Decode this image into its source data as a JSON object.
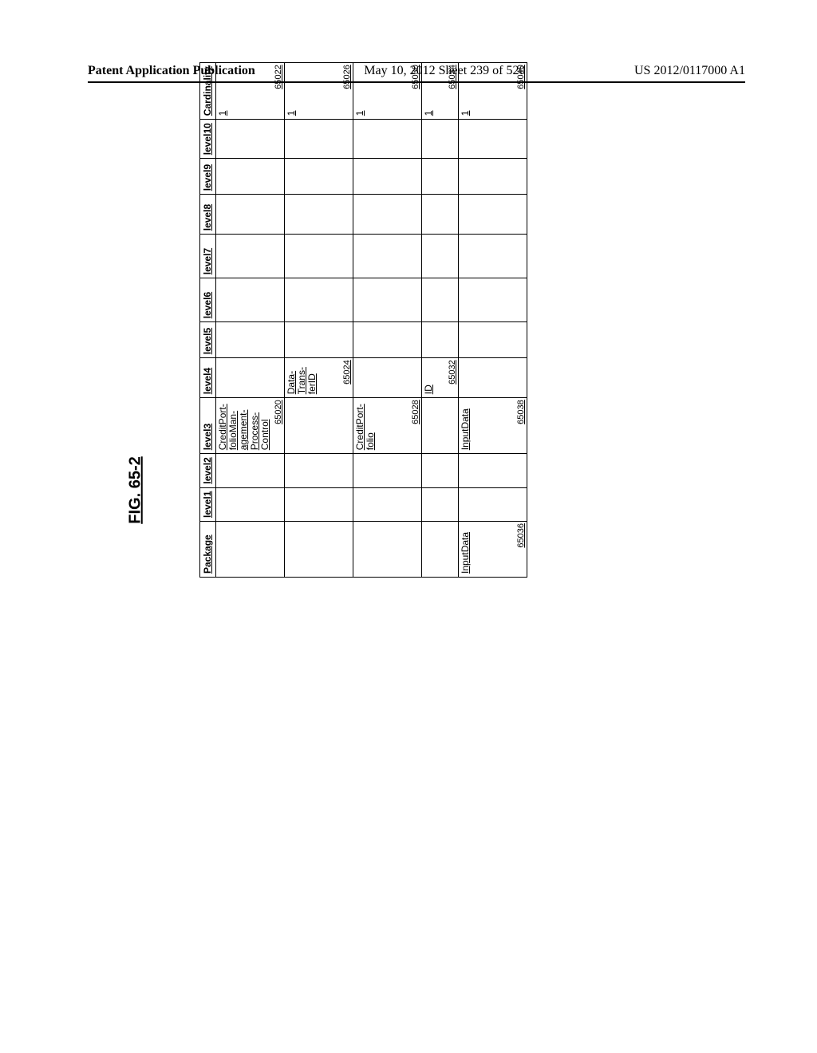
{
  "header": {
    "left": "Patent Application Publication",
    "mid": "May 10, 2012  Sheet 239 of 520",
    "right": "US 2012/0117000 A1"
  },
  "figure_label": "FIG. 65-2",
  "table": {
    "headers": [
      "Package",
      "level1",
      "level2",
      "level3",
      "level4",
      "level5",
      "level6",
      "level7",
      "level8",
      "level9",
      "level10",
      "Cardinality"
    ],
    "rows": [
      {
        "package": {
          "text": "",
          "ref": ""
        },
        "l3": {
          "text": "CreditPort-\nfolioMan-\nagement-\nProcess-\nControl",
          "ref": "65020"
        },
        "l4": {
          "text": "",
          "ref": ""
        },
        "card": {
          "text": "1",
          "ref": "65022"
        }
      },
      {
        "package": {
          "text": "",
          "ref": ""
        },
        "l3": {
          "text": "",
          "ref": ""
        },
        "l4": {
          "text": "Data-\nTrans-\nferID",
          "ref": "65024"
        },
        "card": {
          "text": "1",
          "ref": "65026"
        }
      },
      {
        "package": {
          "text": "",
          "ref": ""
        },
        "l3": {
          "text": "CreditPort-\nfolio",
          "ref": "65028"
        },
        "l4": {
          "text": "",
          "ref": ""
        },
        "card": {
          "text": "1",
          "ref": "65030"
        }
      },
      {
        "package": {
          "text": "",
          "ref": ""
        },
        "l3": {
          "text": "",
          "ref": ""
        },
        "l4": {
          "text": "ID",
          "ref": "65032"
        },
        "card": {
          "text": "1",
          "ref": "65034"
        },
        "short": true
      },
      {
        "package": {
          "text": "InputData",
          "ref": "65036"
        },
        "l3": {
          "text": "InputData",
          "ref": "65038"
        },
        "l4": {
          "text": "",
          "ref": ""
        },
        "card": {
          "text": "1",
          "ref": "65040"
        }
      }
    ]
  }
}
